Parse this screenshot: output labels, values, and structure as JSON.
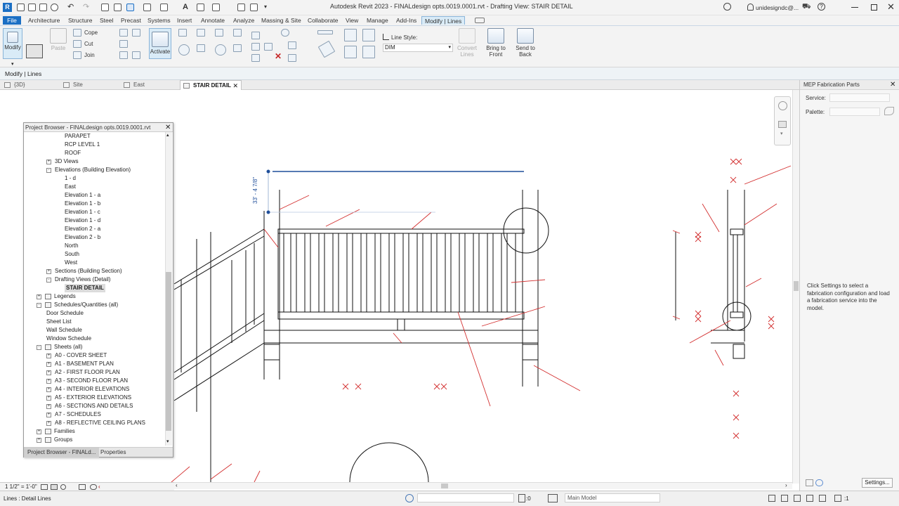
{
  "window": {
    "title": "Autodesk Revit 2023 - FINALdesign opts.0019.0001.rvt - Drafting View: STAIR DETAIL",
    "user": "unidesigndc@..."
  },
  "menu": {
    "file": "File",
    "tabs": [
      "Architecture",
      "Structure",
      "Steel",
      "Precast",
      "Systems",
      "Insert",
      "Annotate",
      "Analyze",
      "Massing & Site",
      "Collaborate",
      "View",
      "Manage",
      "Add-Ins",
      "Modify | Lines"
    ]
  },
  "ribbon": {
    "modify": "Modify",
    "paste": "Paste",
    "cope": "Cope",
    "cut": "Cut",
    "join": "Join",
    "activate": "Activate",
    "line_style_label": "Line Style:",
    "line_style_value": "DIM",
    "convert_lines": "Convert Lines",
    "bring_to_front": "Bring to Front",
    "send_to_back": "Send to Back"
  },
  "context_label": "Modify | Lines",
  "view_tabs": [
    {
      "label": "{3D}",
      "active": false
    },
    {
      "label": "Site",
      "active": false
    },
    {
      "label": "East",
      "active": false
    },
    {
      "label": "STAIR DETAIL",
      "active": true
    }
  ],
  "drawing": {
    "dimension": "33' - 4 7/8\""
  },
  "project_browser": {
    "title": "Project Browser - FINALdesign opts.0019.0001.rvt",
    "items": [
      {
        "label": "PARAPET",
        "level": 3
      },
      {
        "label": "RCP LEVEL 1",
        "level": 3
      },
      {
        "label": "ROOF",
        "level": 3
      },
      {
        "label": "3D Views",
        "level": 1,
        "toggle": "+"
      },
      {
        "label": "Elevations (Building Elevation)",
        "level": 1,
        "toggle": "-"
      },
      {
        "label": "1 - d",
        "level": 3
      },
      {
        "label": "East",
        "level": 3
      },
      {
        "label": "Elevation 1 - a",
        "level": 3
      },
      {
        "label": "Elevation 1 - b",
        "level": 3
      },
      {
        "label": "Elevation 1 - c",
        "level": 3
      },
      {
        "label": "Elevation 1 - d",
        "level": 3
      },
      {
        "label": "Elevation 2 - a",
        "level": 3
      },
      {
        "label": "Elevation 2 - b",
        "level": 3
      },
      {
        "label": "North",
        "level": 3
      },
      {
        "label": "South",
        "level": 3
      },
      {
        "label": "West",
        "level": 3
      },
      {
        "label": "Sections (Building Section)",
        "level": 1,
        "toggle": "+"
      },
      {
        "label": "Drafting Views (Detail)",
        "level": 1,
        "toggle": "-"
      },
      {
        "label": "STAIR DETAIL",
        "level": 3,
        "selected": true
      },
      {
        "label": "Legends",
        "level": 0,
        "toggle": "+",
        "icon": true
      },
      {
        "label": "Schedules/Quantities (all)",
        "level": 0,
        "toggle": "-",
        "icon": true
      },
      {
        "label": "Door Schedule",
        "level": 1
      },
      {
        "label": "Sheet List",
        "level": 1
      },
      {
        "label": "Wall Schedule",
        "level": 1
      },
      {
        "label": "Window Schedule",
        "level": 1
      },
      {
        "label": "Sheets (all)",
        "level": 0,
        "toggle": "-",
        "icon": true
      },
      {
        "label": "A0 - COVER SHEET",
        "level": 1,
        "toggle": "+"
      },
      {
        "label": "A1 - BASEMENT PLAN",
        "level": 1,
        "toggle": "+"
      },
      {
        "label": "A2 - FIRST FLOOR PLAN",
        "level": 1,
        "toggle": "+"
      },
      {
        "label": "A3 - SECOND FLOOR PLAN",
        "level": 1,
        "toggle": "+"
      },
      {
        "label": "A4 - INTERIOR ELEVATIONS",
        "level": 1,
        "toggle": "+"
      },
      {
        "label": "A5 - EXTERIOR ELEVATIONS",
        "level": 1,
        "toggle": "+"
      },
      {
        "label": "A6 - SECTIONS AND DETAILS",
        "level": 1,
        "toggle": "+"
      },
      {
        "label": "A7 - SCHEDULES",
        "level": 1,
        "toggle": "+"
      },
      {
        "label": "A8 - REFLECTIVE CEILING PLANS",
        "level": 1,
        "toggle": "+"
      },
      {
        "label": "Families",
        "level": 0,
        "toggle": "+",
        "icon": true
      },
      {
        "label": "Groups",
        "level": 0,
        "toggle": "+",
        "icon": true
      }
    ],
    "tabs": [
      "Project Browser - FINALd...",
      "Properties"
    ]
  },
  "properties_panel": {
    "title": "MEP Fabrication Parts",
    "service_label": "Service:",
    "palette_label": "Palette:",
    "info": "Click Settings to select a fabrication configuration and load a fabrication service into the model.",
    "settings_button": "Settings..."
  },
  "view_control": {
    "scale": "1 1/2\" = 1'-0\""
  },
  "status": {
    "text": "Lines : Detail Lines",
    "selection_count": ":0",
    "model": "Main Model",
    "filter_count": ":1"
  },
  "colors": {
    "file_tab": "#1b6fc4",
    "dimension": "#1f4e9a",
    "redline": "#d32f2f",
    "context_bg": "#eef3f6"
  }
}
